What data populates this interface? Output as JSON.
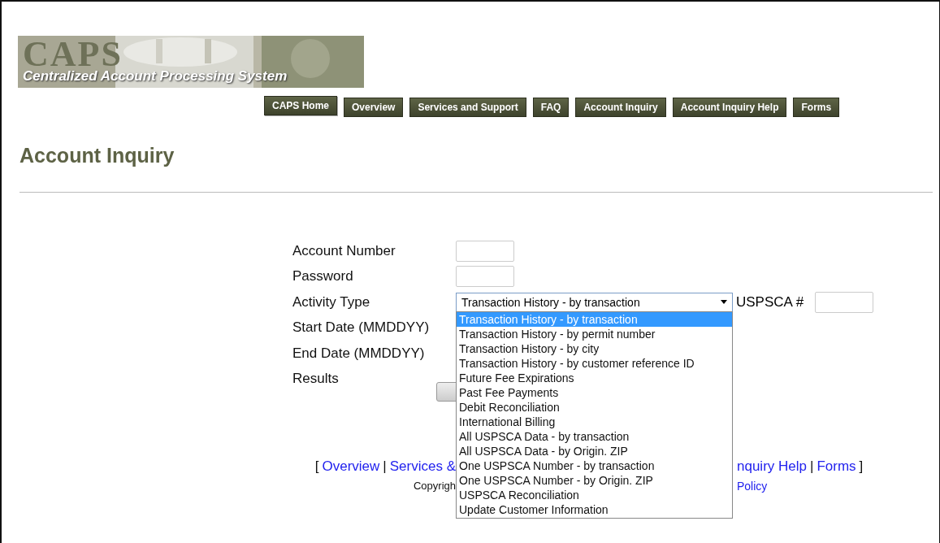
{
  "logo": {
    "acronym": "CAPS",
    "tagline": "Centralized Account Processing System"
  },
  "nav": [
    {
      "label": "CAPS Home",
      "selected": true
    },
    {
      "label": "Overview",
      "selected": false
    },
    {
      "label": "Services and Support",
      "selected": false
    },
    {
      "label": "FAQ",
      "selected": false
    },
    {
      "label": "Account Inquiry",
      "selected": false
    },
    {
      "label": "Account Inquiry Help",
      "selected": false
    },
    {
      "label": "Forms",
      "selected": false
    }
  ],
  "page_title": "Account Inquiry",
  "form": {
    "rows": [
      {
        "label": "Account Number",
        "kind": "input"
      },
      {
        "label": "Password",
        "kind": "input"
      },
      {
        "label": "Activity Type",
        "kind": "select"
      },
      {
        "label": "Start Date (MMDDYY)",
        "kind": "hidden"
      },
      {
        "label": "End Date (MMDDYY)",
        "kind": "hidden"
      },
      {
        "label": "Results",
        "kind": "hidden"
      }
    ],
    "activity_value": "Transaction History - by transaction",
    "uspsca_label": "USPSCA #",
    "dropdown_options": [
      {
        "label": "Transaction History - by transaction",
        "selected": true
      },
      {
        "label": "Transaction History - by permit number",
        "selected": false
      },
      {
        "label": "Transaction History - by city",
        "selected": false
      },
      {
        "label": "Transaction History - by customer reference ID",
        "selected": false
      },
      {
        "label": "Future Fee Expirations",
        "selected": false
      },
      {
        "label": "Past Fee Payments",
        "selected": false
      },
      {
        "label": "Debit Reconciliation",
        "selected": false
      },
      {
        "label": "International Billing",
        "selected": false
      },
      {
        "label": "All USPSCA Data - by transaction",
        "selected": false
      },
      {
        "label": "All USPSCA Data - by Origin. ZIP",
        "selected": false
      },
      {
        "label": "One USPSCA Number - by transaction",
        "selected": false
      },
      {
        "label": "One USPSCA Number - by Origin. ZIP",
        "selected": false
      },
      {
        "label": "USPSCA Reconciliation",
        "selected": false
      },
      {
        "label": "Update Customer Information",
        "selected": false
      }
    ]
  },
  "footer": {
    "left": [
      {
        "kind": "punct",
        "text": "["
      },
      {
        "kind": "link",
        "text": "Overview"
      },
      {
        "kind": "punct",
        "text": "|"
      },
      {
        "kind": "link",
        "text": "Services &"
      }
    ],
    "right": [
      {
        "kind": "link",
        "text": "nquiry Help"
      },
      {
        "kind": "punct",
        "text": "|"
      },
      {
        "kind": "link",
        "text": "Forms"
      },
      {
        "kind": "punct",
        "text": "]"
      }
    ],
    "copyright_left": "Copyrigh",
    "copyright_right": "Policy"
  }
}
